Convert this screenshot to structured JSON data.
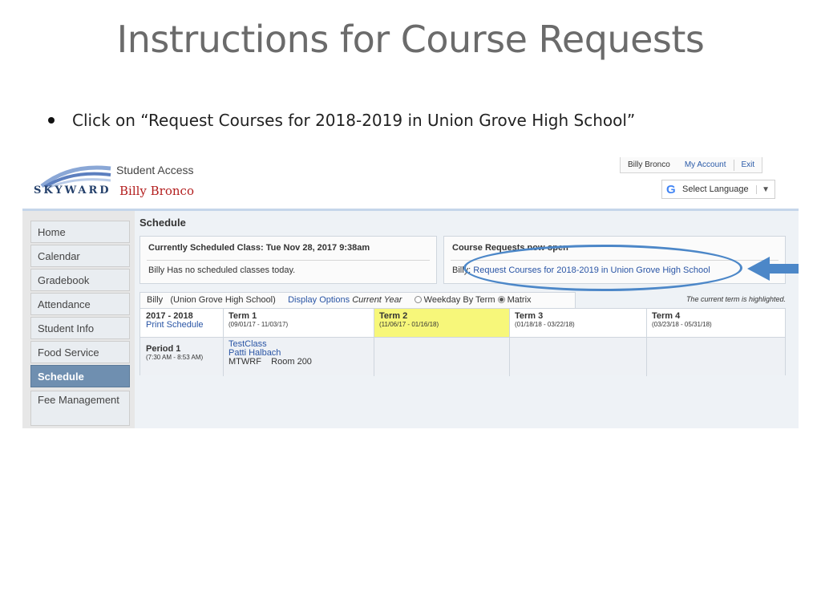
{
  "slide": {
    "title": "Instructions for Course Requests",
    "bullet": "Click on “Request Courses for 2018-2019 in Union Grove High School”"
  },
  "header": {
    "logo_text": "SKYWARD",
    "app_name": "Student Access",
    "user_name": "Billy Bronco",
    "account_links": [
      "Billy Bronco",
      "My Account",
      "Exit"
    ],
    "language_button": "Select Language"
  },
  "sidebar": {
    "items": [
      {
        "label": "Home"
      },
      {
        "label": "Calendar"
      },
      {
        "label": "Gradebook"
      },
      {
        "label": "Attendance"
      },
      {
        "label": "Student Info"
      },
      {
        "label": "Food Service"
      },
      {
        "label": "Schedule",
        "active": true
      },
      {
        "label": "Fee Management"
      }
    ]
  },
  "schedule": {
    "title": "Schedule",
    "current_class_heading": "Currently Scheduled Class: Tue Nov 28, 2017 9:38am",
    "current_class_body": "Billy Has no scheduled classes today.",
    "course_requests_heading": "Course Requests now open",
    "course_requests_prefix": "Billy:",
    "course_requests_link": "Request Courses for 2018-2019 in Union Grove High School",
    "tab_student": "Billy",
    "tab_school": "(Union Grove High School)",
    "display_options": "Display Options",
    "current_year": "Current Year",
    "view_weekday": "Weekday By Term",
    "view_matrix": "Matrix",
    "term_note": "The current term is highlighted.",
    "year": "2017 - 2018",
    "print_schedule": "Print Schedule",
    "terms": [
      {
        "name": "Term 1",
        "dates": "(09/01/17 - 11/03/17)"
      },
      {
        "name": "Term 2",
        "dates": "(11/06/17 - 01/16/18)",
        "highlighted": true
      },
      {
        "name": "Term 3",
        "dates": "(01/18/18 - 03/22/18)"
      },
      {
        "name": "Term 4",
        "dates": "(03/23/18 - 05/31/18)"
      }
    ],
    "period": {
      "name": "Period 1",
      "time": "(7:30 AM - 8:53 AM)",
      "class": "TestClass",
      "teacher": "Patti Halbach",
      "days": "MTWRF",
      "room": "Room 200"
    }
  },
  "colors": {
    "highlight": "#f7f77a",
    "callout": "#4c87c8",
    "active_nav": "#6f8fb0",
    "user_name": "#b31e1e"
  }
}
